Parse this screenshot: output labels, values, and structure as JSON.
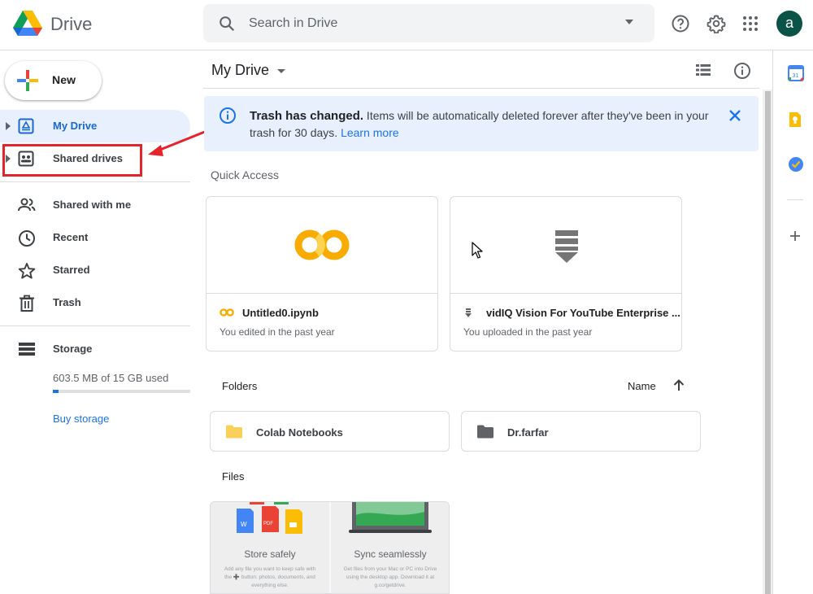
{
  "header": {
    "app_name": "Drive",
    "search_placeholder": "Search in Drive",
    "avatar_letter": "a"
  },
  "sidebar": {
    "new_label": "New",
    "items": [
      {
        "label": "My Drive",
        "icon": "my-drive-icon",
        "active": true
      },
      {
        "label": "Shared drives",
        "icon": "shared-drives-icon"
      },
      {
        "label": "Shared with me",
        "icon": "people-icon"
      },
      {
        "label": "Recent",
        "icon": "clock-icon"
      },
      {
        "label": "Starred",
        "icon": "star-icon"
      },
      {
        "label": "Trash",
        "icon": "trash-icon"
      },
      {
        "label": "Storage",
        "icon": "storage-icon"
      }
    ],
    "storage_used": "603.5 MB of 15 GB used",
    "storage_fraction": 0.04,
    "buy_storage": "Buy storage"
  },
  "main": {
    "title": "My Drive",
    "banner": {
      "title": "Trash has changed.",
      "text": " Items will be automatically deleted forever after they've been in your trash for 30 days. ",
      "link": "Learn more"
    },
    "quick_access_label": "Quick Access",
    "quick_access": [
      {
        "name": "Untitled0.ipynb",
        "subtitle": "You edited in the past year",
        "icon": "colab-icon"
      },
      {
        "name": "vidIQ Vision For YouTube Enterprise ...",
        "subtitle": "You uploaded in the past year",
        "icon": "file-icon"
      }
    ],
    "folders_label": "Folders",
    "sort_label": "Name",
    "folders": [
      {
        "name": "Colab Notebooks",
        "color": "#fbd058"
      },
      {
        "name": "Dr.farfar",
        "color": "#5f6368"
      }
    ],
    "files_label": "Files",
    "promo": [
      {
        "title": "Store safely",
        "desc": "Add any file you want to keep safe with the ➕ button: photos, documents, and everything else."
      },
      {
        "title": "Sync seamlessly",
        "desc": "Get files from your Mac or PC into Drive using the desktop app. Download it at g.co/getdrive."
      }
    ]
  },
  "colors": {
    "accent": "#1a73e8",
    "active_bg": "#e8f0fe",
    "highlight": "#e5232b",
    "avatar_bg": "#0b5347"
  }
}
